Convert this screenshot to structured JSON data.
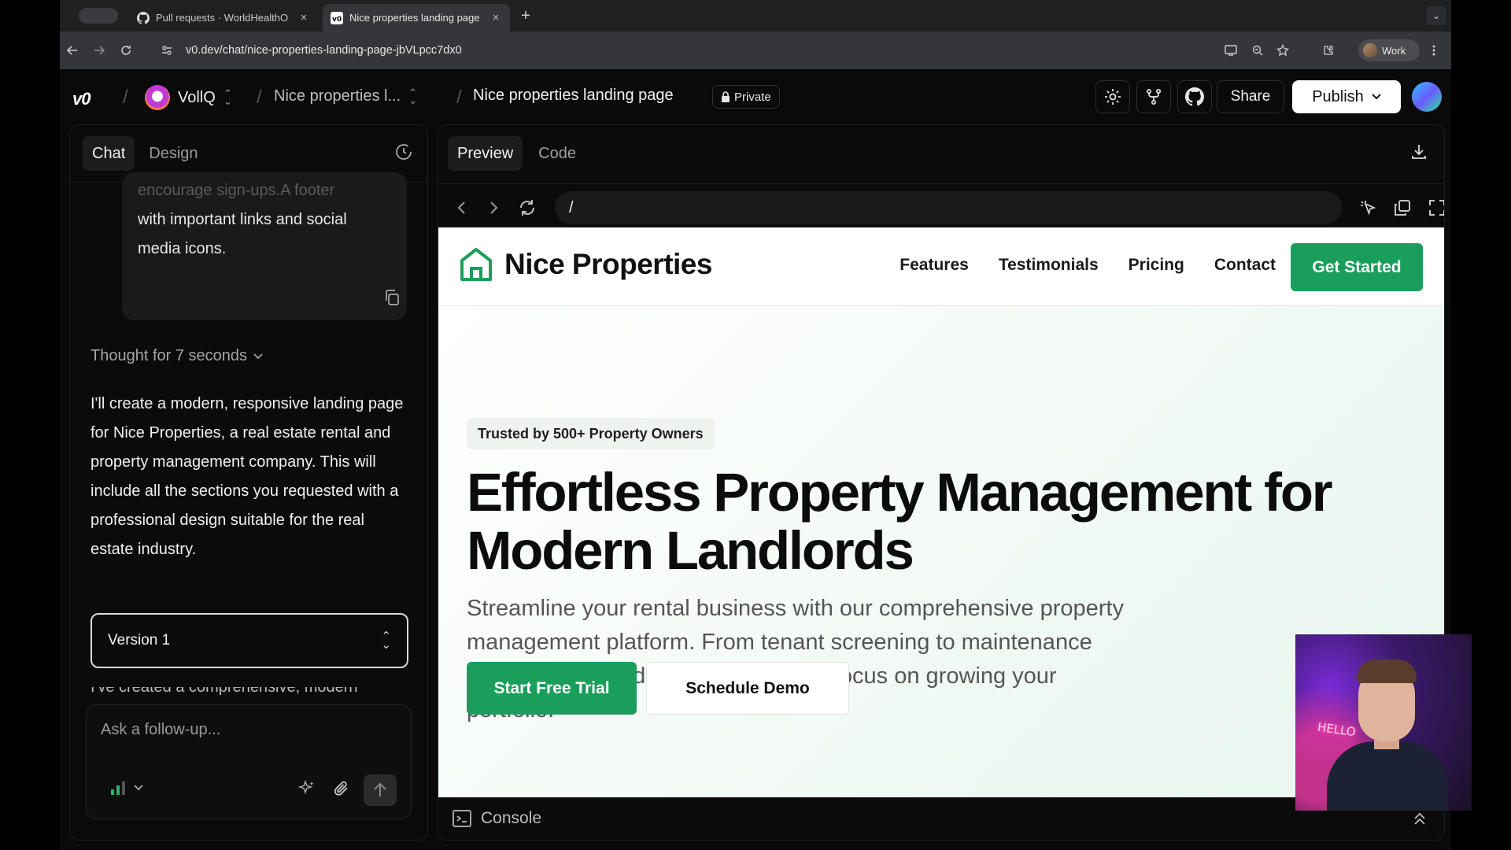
{
  "browser": {
    "tabs": [
      {
        "title": "Pull requests · WorldHealthO",
        "icon": "github-icon"
      },
      {
        "title": "Nice properties landing page",
        "icon": "v0-icon",
        "active": true
      }
    ],
    "url": "v0.dev/chat/nice-properties-landing-page-jbVLpcc7dx0",
    "profile_label": "Work"
  },
  "app": {
    "logo": "v0",
    "team": "VollQ",
    "project": "Nice properties l...",
    "chat_title": "Nice properties landing page",
    "visibility": "Private",
    "share_label": "Share",
    "publish_label": "Publish"
  },
  "left": {
    "tabs": [
      "Chat",
      "Design"
    ],
    "user_message_faded": "encourage sign-ups.A footer",
    "user_message": "with important links and social media icons.",
    "thought": "Thought for 7 seconds",
    "response": "I'll create a modern, responsive landing page for Nice Properties, a real estate rental and property management company. This will include all the sections you requested with a professional design suitable for the real estate industry.",
    "version": "Version 1",
    "response_cut": "I've created a comprehensive, modern",
    "composer_placeholder": "Ask a follow-up..."
  },
  "right": {
    "tabs": [
      "Preview",
      "Code"
    ],
    "preview_path": "/",
    "console_label": "Console"
  },
  "site": {
    "brand": "Nice Properties",
    "nav": [
      "Features",
      "Testimonials",
      "Pricing",
      "Contact"
    ],
    "cta": "Get Started",
    "badge": "Trusted by 500+ Property Owners",
    "headline": "Effortless Property Management for Modern Landlords",
    "subheadline": "Streamline your rental business with our comprehensive property management platform. From tenant screening to maintenance tracking, we handle it all so you can focus on growing your portfolio.",
    "primary_button": "Start Free Trial",
    "secondary_button": "Schedule Demo",
    "accent": "#1a9e5c"
  },
  "webcam": {
    "sign_text": "HELLO"
  }
}
